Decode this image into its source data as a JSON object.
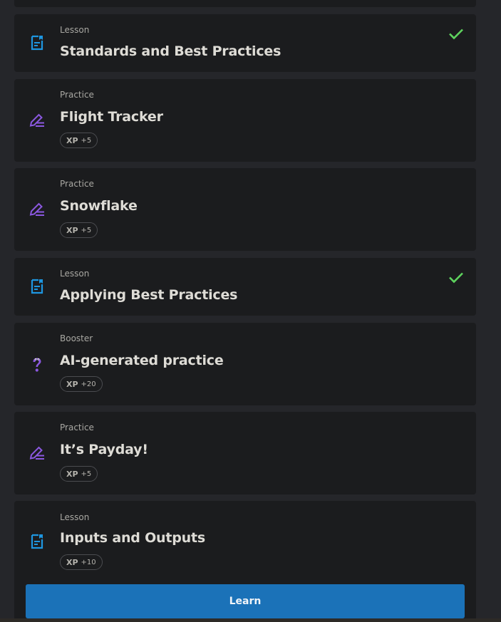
{
  "items": [
    {
      "type": "Lesson",
      "title": "Standards and Best Practices",
      "completed": true,
      "icon": "lesson-doc-icon"
    },
    {
      "type": "Practice",
      "title": "Flight Tracker",
      "xp_label": "XP",
      "xp_value": "+5",
      "icon": "practice-pencil-icon"
    },
    {
      "type": "Practice",
      "title": "Snowflake",
      "xp_label": "XP",
      "xp_value": "+5",
      "icon": "practice-pencil-icon"
    },
    {
      "type": "Lesson",
      "title": "Applying Best Practices",
      "completed": true,
      "icon": "lesson-doc-icon"
    },
    {
      "type": "Booster",
      "title": "AI-generated practice",
      "xp_label": "XP",
      "xp_value": "+20",
      "icon": "booster-question-icon"
    },
    {
      "type": "Practice",
      "title": "It’s Payday!",
      "xp_label": "XP",
      "xp_value": "+5",
      "icon": "practice-pencil-icon"
    },
    {
      "type": "Lesson",
      "title": "Inputs and Outputs",
      "xp_label": "XP",
      "xp_value": "+10",
      "icon": "lesson-doc-icon"
    }
  ],
  "learn_button": {
    "label": "Learn"
  },
  "colors": {
    "lesson_icon": "#1e96e0",
    "practice_icon": "#8b58e0",
    "check": "#5ed35e",
    "button": "#1b72b8",
    "card": "#1b1c1e"
  }
}
